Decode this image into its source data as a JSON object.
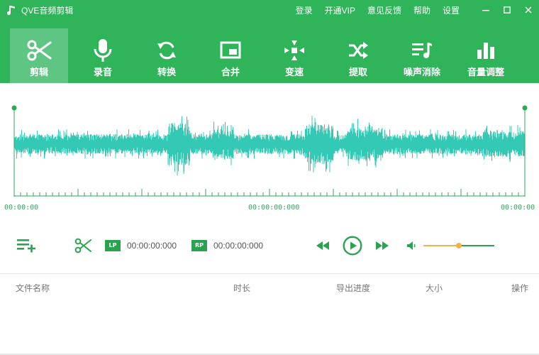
{
  "app": {
    "title": "QVE音频剪辑",
    "accent": "#2fb45a"
  },
  "top_links": [
    "登录",
    "开通VIP",
    "意见反馈",
    "帮助",
    "设置"
  ],
  "tools": [
    {
      "label": "剪辑",
      "icon": "scissors-icon",
      "active": true
    },
    {
      "label": "录音",
      "icon": "microphone-icon",
      "active": false
    },
    {
      "label": "转换",
      "icon": "convert-icon",
      "active": false
    },
    {
      "label": "合并",
      "icon": "merge-icon",
      "active": false
    },
    {
      "label": "变速",
      "icon": "speed-icon",
      "active": false
    },
    {
      "label": "提取",
      "icon": "extract-icon",
      "active": false
    },
    {
      "label": "噪声消除",
      "icon": "noise-removal-icon",
      "active": false
    },
    {
      "label": "音量调整",
      "icon": "volume-adjust-icon",
      "active": false
    }
  ],
  "waveform": {
    "start_time": "00:00:00",
    "center_time": "00:00:00:000",
    "end_time": "00:00:00"
  },
  "controls": {
    "lp_label": "LP",
    "lp_time": "00:00:00:000",
    "rp_label": "RP",
    "rp_time": "00:00:00:000",
    "volume_level": 0.5
  },
  "file_table": {
    "columns": [
      "文件名称",
      "时长",
      "导出进度",
      "大小",
      "操作"
    ],
    "rows": []
  }
}
